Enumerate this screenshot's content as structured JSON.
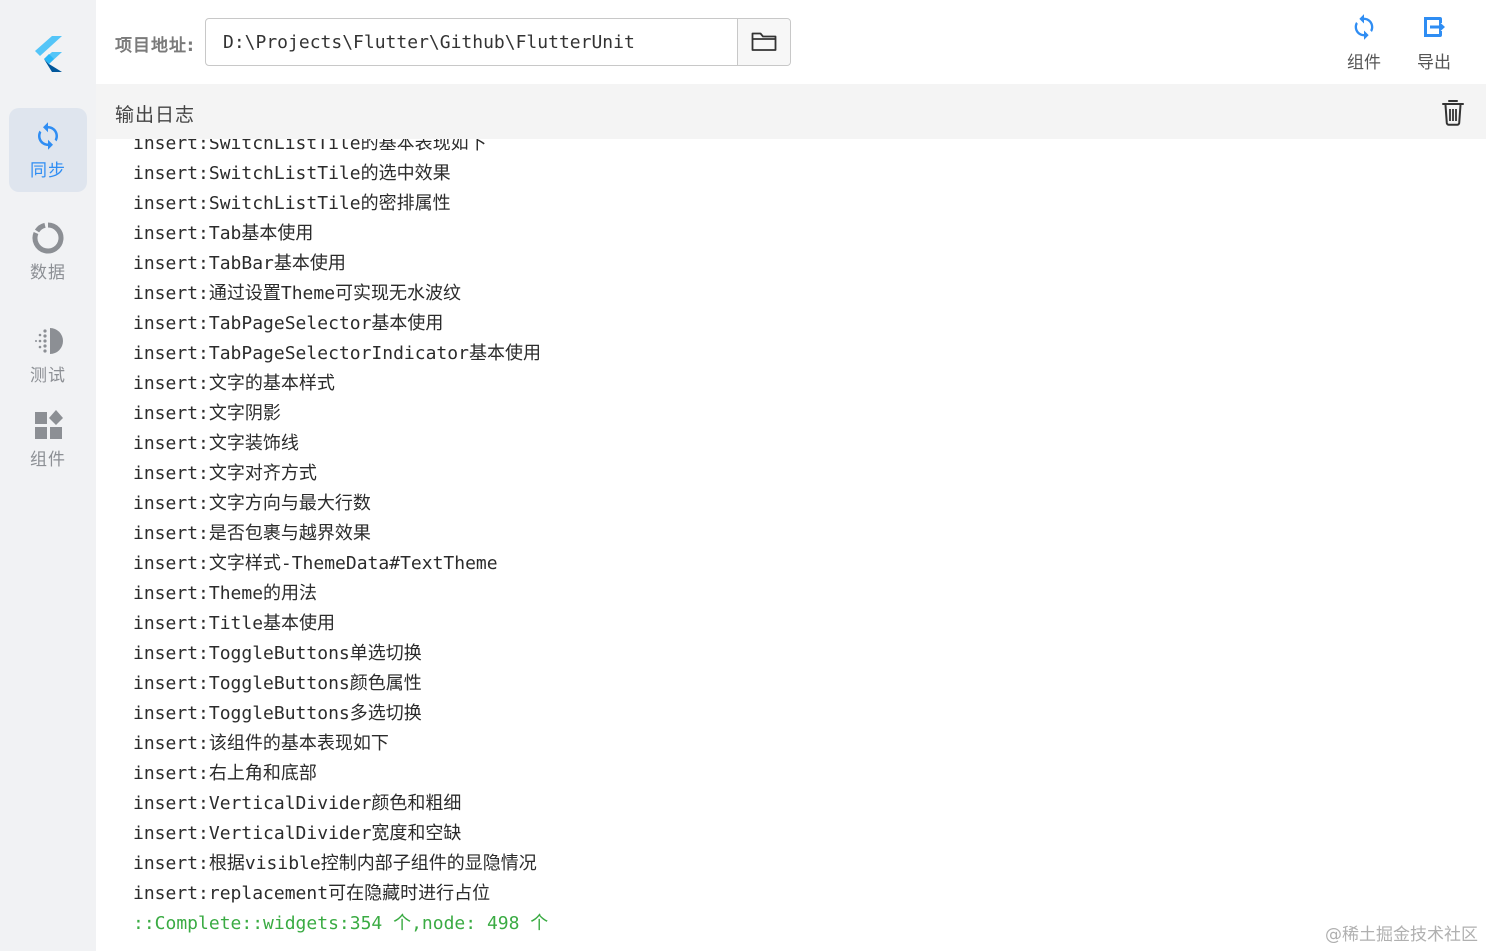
{
  "sidebar": {
    "items": [
      {
        "label": "同步",
        "icon": "sync-icon",
        "active": true
      },
      {
        "label": "数据",
        "icon": "circle-progress-icon",
        "active": false
      },
      {
        "label": "测试",
        "icon": "dotted-half-circle-icon",
        "active": false
      },
      {
        "label": "组件",
        "icon": "widgets-icon",
        "active": false
      }
    ]
  },
  "topbar": {
    "address_label": "项目地址:",
    "address_value": "D:\\Projects\\Flutter\\Github\\FlutterUnit",
    "actions": [
      {
        "label": "组件",
        "icon": "sync-icon"
      },
      {
        "label": "导出",
        "icon": "export-icon"
      }
    ]
  },
  "log": {
    "title": "输出日志",
    "lines": [
      "insert:SwitchListTile的基本表现如下",
      "insert:SwitchListTile的选中效果",
      "insert:SwitchListTile的密排属性",
      "insert:Tab基本使用",
      "insert:TabBar基本使用",
      "insert:通过设置Theme可实现无水波纹",
      "insert:TabPageSelector基本使用",
      "insert:TabPageSelectorIndicator基本使用",
      "insert:文字的基本样式",
      "insert:文字阴影",
      "insert:文字装饰线",
      "insert:文字对齐方式",
      "insert:文字方向与最大行数",
      "insert:是否包裹与越界效果",
      "insert:文字样式-ThemeData#TextTheme",
      "insert:Theme的用法",
      "insert:Title基本使用",
      "insert:ToggleButtons单选切换",
      "insert:ToggleButtons颜色属性",
      "insert:ToggleButtons多选切换",
      "insert:该组件的基本表现如下",
      "insert:右上角和底部",
      "insert:VerticalDivider颜色和粗细",
      "insert:VerticalDivider宽度和空缺",
      "insert:根据visible控制内部子组件的显隐情况",
      "insert:replacement可在隐藏时进行占位"
    ],
    "complete": "::Complete::widgets:354 个,node: 498 个"
  },
  "watermark": "@稀土掘金技术社区",
  "colors": {
    "accent": "#2f8df3",
    "success": "#3aab43",
    "sidebar_bg": "#f1f2f4"
  }
}
